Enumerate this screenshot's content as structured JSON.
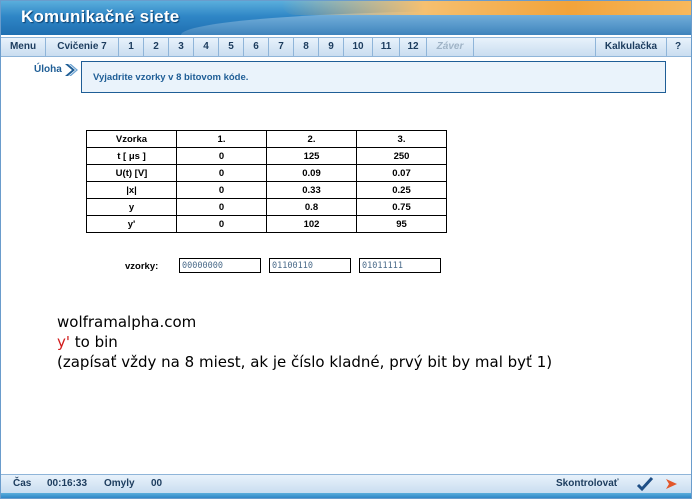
{
  "app": {
    "title": "Komunikačné siete"
  },
  "nav": {
    "menu": "Menu",
    "exercise": "Cvičenie 7",
    "pages": [
      "1",
      "2",
      "3",
      "4",
      "5",
      "6",
      "7",
      "8",
      "9",
      "10",
      "11",
      "12"
    ],
    "conclusion": "Záver",
    "calculator": "Kalkulačka",
    "help": "?"
  },
  "task": {
    "label": "Úloha",
    "text": "Vyjadrite vzorky v 8 bitovom kóde."
  },
  "table": {
    "headers": [
      "Vzorka",
      "1.",
      "2.",
      "3."
    ],
    "rows": [
      [
        "t [ μs ]",
        "0",
        "125",
        "250"
      ],
      [
        "U(t) [V]",
        "0",
        "0.09",
        "0.07"
      ],
      [
        "|x|",
        "0",
        "0.33",
        "0.25"
      ],
      [
        "y",
        "0",
        "0.8",
        "0.75"
      ],
      [
        "y'",
        "0",
        "102",
        "95"
      ]
    ]
  },
  "samples": {
    "label": "vzorky:",
    "values": [
      "00000000",
      "01100110",
      "01011111"
    ]
  },
  "notes": {
    "line1": "wolframalpha.com",
    "line2_red": "y'",
    "line2_rest": " to bin",
    "line3": "(zapísať vždy na 8 miest, ak je číslo kladné, prvý bit by mal byť 1)"
  },
  "footer": {
    "time_label": "Čas",
    "time_value": "00:16:33",
    "errors_label": "Omyly",
    "errors_value": "00",
    "check": "Skontrolovať"
  },
  "colors": {
    "accent": "#1f5e96",
    "title_blue": "#2f86c6",
    "orange": "#f2a33a",
    "note_red": "#d11a1a"
  }
}
